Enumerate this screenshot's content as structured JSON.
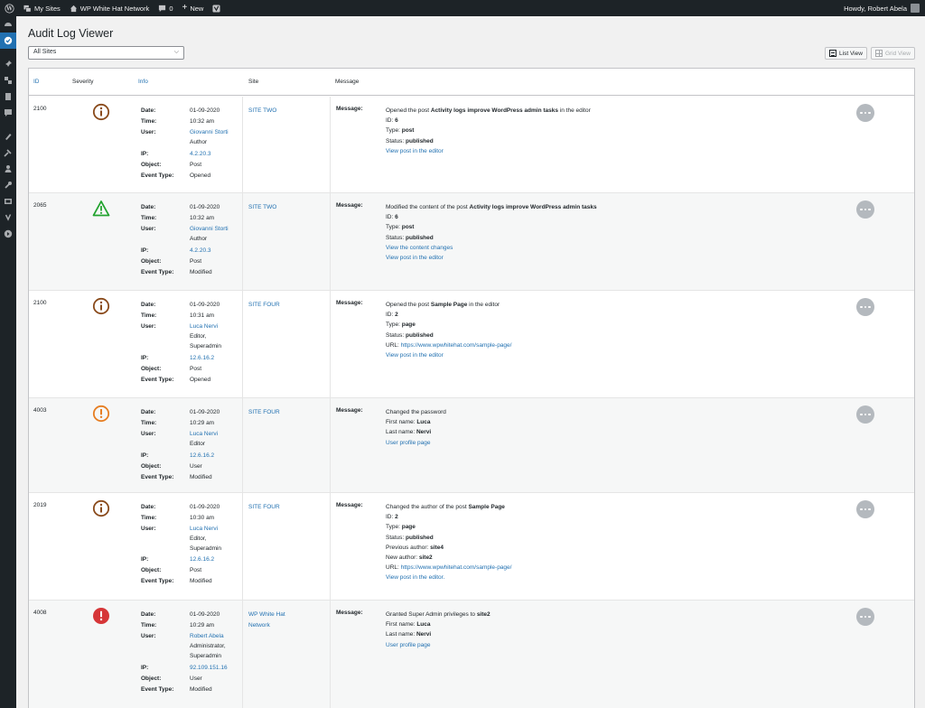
{
  "adminbar": {
    "my_sites": "My Sites",
    "network": "WP White Hat Network",
    "comments_count": "0",
    "new_label": "New",
    "howdy": "Howdy, Robert Abela"
  },
  "page": {
    "title": "Audit Log Viewer",
    "site_filter": "All Sites",
    "list_view": "List View",
    "grid_view": "Grid View"
  },
  "columns": {
    "id": "ID",
    "severity": "Severity",
    "info": "Info",
    "site": "Site",
    "message": "Message"
  },
  "info_labels": {
    "date": "Date:",
    "time": "Time:",
    "user": "User:",
    "ip": "IP:",
    "object": "Object:",
    "event_type": "Event Type:",
    "message": "Message:"
  },
  "colors": {
    "accent": "#2271b1",
    "info": "#8a4b1c",
    "warning": "#22a32f",
    "notice": "#e67e22",
    "critical": "#d63638"
  },
  "rows": [
    {
      "id": "2100",
      "severity_icon": "info-circle-icon",
      "date": "01-09-2020",
      "time": "10:32 am",
      "user": "Giovanni Storti",
      "role": "Author",
      "ip": "4.2.20.3",
      "object": "Post",
      "event_type": "Opened",
      "site": "SITE TWO",
      "message": {
        "l1_pre": "Opened the post ",
        "l1_bold": "Activity logs improve WordPress admin tasks",
        "l1_post": " in the editor",
        "id_label": "ID: ",
        "id_value": "6",
        "type_label": "Type: ",
        "type_value": "post",
        "status_label": "Status: ",
        "status_value": "published",
        "link1": "View post in the editor"
      }
    },
    {
      "id": "2065",
      "severity_icon": "warning-triangle-icon",
      "date": "01-09-2020",
      "time": "10:32 am",
      "user": "Giovanni Storti",
      "role": "Author",
      "ip": "4.2.20.3",
      "object": "Post",
      "event_type": "Modified",
      "site": "SITE TWO",
      "message": {
        "l1_pre": "Modified the content of the post ",
        "l1_bold": "Activity logs improve WordPress admin tasks",
        "id_label": "ID: ",
        "id_value": "6",
        "type_label": "Type: ",
        "type_value": "post",
        "status_label": "Status: ",
        "status_value": "published",
        "link1": "View the content changes",
        "link2": "View post in the editor"
      }
    },
    {
      "id": "2100",
      "severity_icon": "info-circle-icon",
      "date": "01-09-2020",
      "time": "10:31 am",
      "user": "Luca Nervi",
      "role1": "Editor,",
      "role2": "Superadmin",
      "ip": "12.6.16.2",
      "object": "Post",
      "event_type": "Opened",
      "site": "SITE FOUR",
      "message": {
        "l1_pre": "Opened the post ",
        "l1_bold": "Sample Page",
        "l1_post": " in the editor",
        "id_label": "ID: ",
        "id_value": "2",
        "type_label": "Type: ",
        "type_value": "page",
        "status_label": "Status: ",
        "status_value": "published",
        "url_label": "URL: ",
        "url": "https://www.wpwhitehat.com/sample-page/",
        "link1": "View post in the editor"
      }
    },
    {
      "id": "4003",
      "severity_icon": "notice-circle-icon",
      "date": "01-09-2020",
      "time": "10:29 am",
      "user": "Luca Nervi",
      "role": "Editor",
      "ip": "12.6.16.2",
      "object": "User",
      "event_type": "Modified",
      "site": "SITE FOUR",
      "message": {
        "l1": "Changed the password",
        "first_label": "First name: ",
        "first_value": "Luca",
        "last_label": "Last name: ",
        "last_value": "Nervi",
        "link1": "User profile page"
      }
    },
    {
      "id": "2019",
      "severity_icon": "info-circle-icon",
      "date": "01-09-2020",
      "time": "10:30 am",
      "user": "Luca Nervi",
      "role1": "Editor,",
      "role2": "Superadmin",
      "ip": "12.6.16.2",
      "object": "Post",
      "event_type": "Modified",
      "site": "SITE FOUR",
      "message": {
        "l1_pre": "Changed the author of the post ",
        "l1_bold": "Sample Page",
        "id_label": "ID: ",
        "id_value": "2",
        "type_label": "Type: ",
        "type_value": "page",
        "status_label": "Status: ",
        "status_value": "published",
        "prev_label": "Previous author: ",
        "prev_value": "site4",
        "new_label": "New author: ",
        "new_value": "site2",
        "url_label": "URL: ",
        "url": "https://www.wpwhitehat.com/sample-page/",
        "link1": "View post in the editor."
      }
    },
    {
      "id": "4008",
      "severity_icon": "critical-circle-icon",
      "date": "01-09-2020",
      "time": "10:29 am",
      "user": "Robert Abela",
      "role1": "Administrator,",
      "role2": "Superadmin",
      "ip": "92.109.151.16",
      "object": "User",
      "event_type": "Modified",
      "site1": "WP White Hat",
      "site2": "Network",
      "message": {
        "l1_pre": "Granted Super Admin privileges to ",
        "l1_bold": "site2",
        "first_label": "First name: ",
        "first_value": "Luca",
        "last_label": "Last name: ",
        "last_value": "Nervi",
        "link1": "User profile page"
      }
    }
  ]
}
